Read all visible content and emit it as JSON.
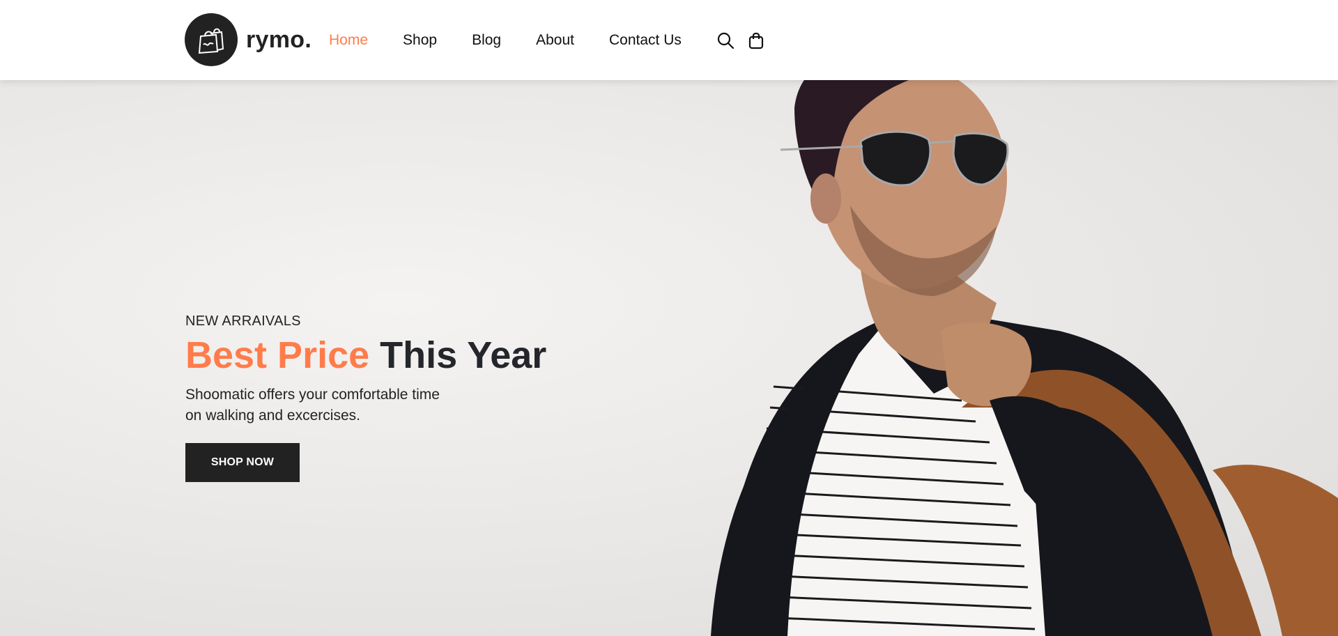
{
  "brand": {
    "name": "rymo.",
    "logo_icon": "shopping-bag-icon"
  },
  "nav": {
    "items": [
      {
        "label": "Home",
        "active": true
      },
      {
        "label": "Shop",
        "active": false
      },
      {
        "label": "Blog",
        "active": false
      },
      {
        "label": "About",
        "active": false
      },
      {
        "label": "Contact Us",
        "active": false
      }
    ],
    "icons": [
      "search-icon",
      "cart-bag-icon"
    ]
  },
  "hero": {
    "eyebrow": "NEW ARRAIVALS",
    "headline_accent": "Best Price",
    "headline_rest": "This Year",
    "description_line1": "Shoomatic offers your comfortable time",
    "description_line2": "on walking and excercises.",
    "button_label": "SHOP NOW",
    "image": "man-with-sunglasses-beanie-leather-bag"
  },
  "colors": {
    "accent": "#ff7c4a",
    "dark": "#222222",
    "headline": "#24262b",
    "background": "#ebe9e7"
  }
}
